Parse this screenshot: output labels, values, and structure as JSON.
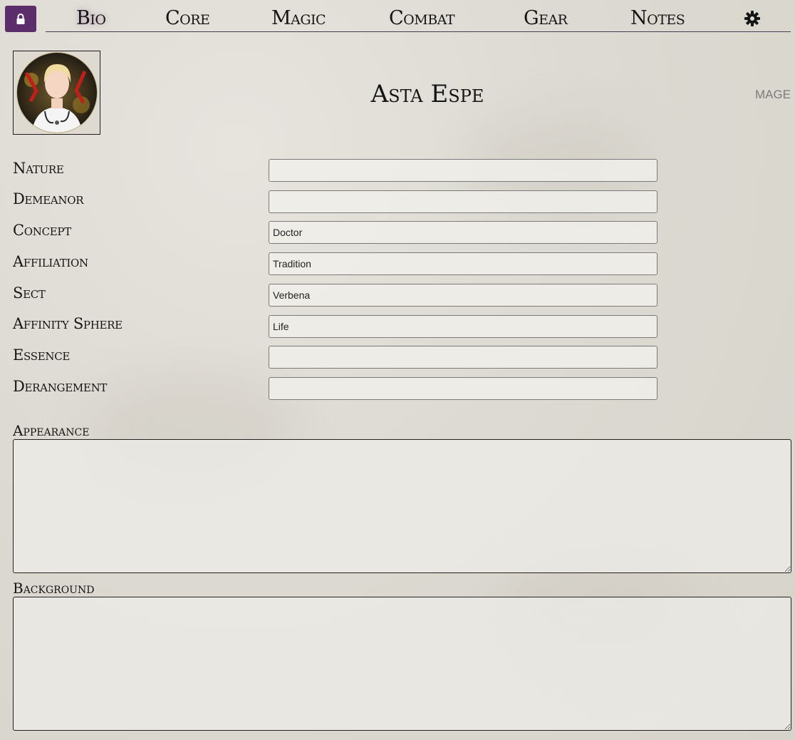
{
  "nav": {
    "tabs": [
      {
        "label": "Bio",
        "active": true
      },
      {
        "label": "Core",
        "active": false
      },
      {
        "label": "Magic",
        "active": false
      },
      {
        "label": "Combat",
        "active": false
      },
      {
        "label": "Gear",
        "active": false
      },
      {
        "label": "Notes",
        "active": false
      }
    ],
    "lock_icon": "lock-icon",
    "settings_icon": "gear-icon",
    "accent_color": "#5b2d6b"
  },
  "character": {
    "name": "Asta Espe",
    "type": "MAGE",
    "portrait_icon": "avatar"
  },
  "fields": [
    {
      "label": "Nature",
      "value": ""
    },
    {
      "label": "Demeanor",
      "value": ""
    },
    {
      "label": "Concept",
      "value": "Doctor"
    },
    {
      "label": "Affiliation",
      "value": "Tradition"
    },
    {
      "label": "Sect",
      "value": "Verbena"
    },
    {
      "label": "Affinity Sphere",
      "value": "Life"
    },
    {
      "label": "Essence",
      "value": ""
    },
    {
      "label": "Derangement",
      "value": ""
    }
  ],
  "sections": {
    "appearance": {
      "label": "Appearance",
      "value": ""
    },
    "background": {
      "label": "Background",
      "value": ""
    }
  }
}
